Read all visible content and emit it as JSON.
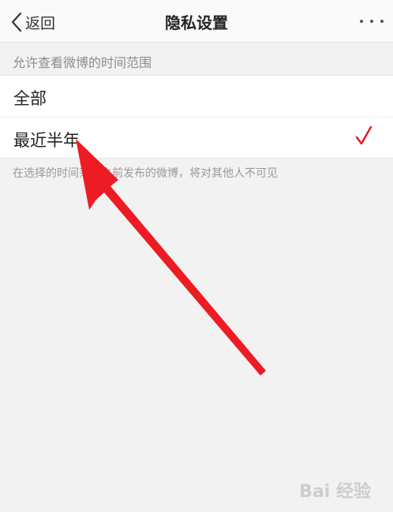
{
  "nav": {
    "back_label": "返回",
    "title": "隐私设置"
  },
  "section": {
    "header": "允许查看微博的时间范围"
  },
  "options": [
    {
      "label": "全部",
      "selected": false
    },
    {
      "label": "最近半年",
      "selected": true
    }
  ],
  "footer_note": "在选择的时间范围之前发布的微博，将对其他人不可见",
  "watermark": "Bai 经验",
  "colors": {
    "check": "#e8141c",
    "arrow": "#ed1c24"
  }
}
